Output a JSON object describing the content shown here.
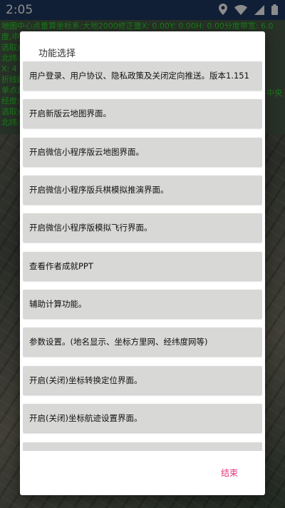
{
  "status_bar": {
    "time": "2:05",
    "icons": [
      "location-icon",
      "wifi-icon",
      "signal-icon",
      "battery-icon"
    ]
  },
  "background_overlay": {
    "lines": [
      "地图中心点量算坐标系:大地2000修正量X: 0.00Y: 0.00H: 0.00分度带宽: 6.0",
      "度,中",
      "选取点",
      "北纬:",
      "X: 4",
      "折线距",
      "单点量",
      "经度:",
      "选取点",
      "北纬:"
    ],
    "side_text": "中央"
  },
  "dialog": {
    "title": "功能选择",
    "options": [
      "用户登录、用户协议、隐私政策及关闭定向推送。版本1.151",
      "开启新版云地图界面。",
      "开启微信小程序版云地图界面。",
      "开启微信小程序版兵棋模拟推演界面。",
      "开启微信小程序版模拟飞行界面。",
      "查看作者成就PPT",
      "辅助计算功能。",
      "参数设置。(地名显示、坐标方里网、经纬度网等)",
      "开启(关闭)坐标转换定位界面。",
      "开启(关闭)坐标航迹设置界面。",
      ""
    ],
    "end_label": "结束"
  },
  "colors": {
    "status_bar": "#1f3a63",
    "overlay_text": "#2ee02e",
    "end_button": "#e3357a",
    "option_bg": "#d8d8d6"
  }
}
